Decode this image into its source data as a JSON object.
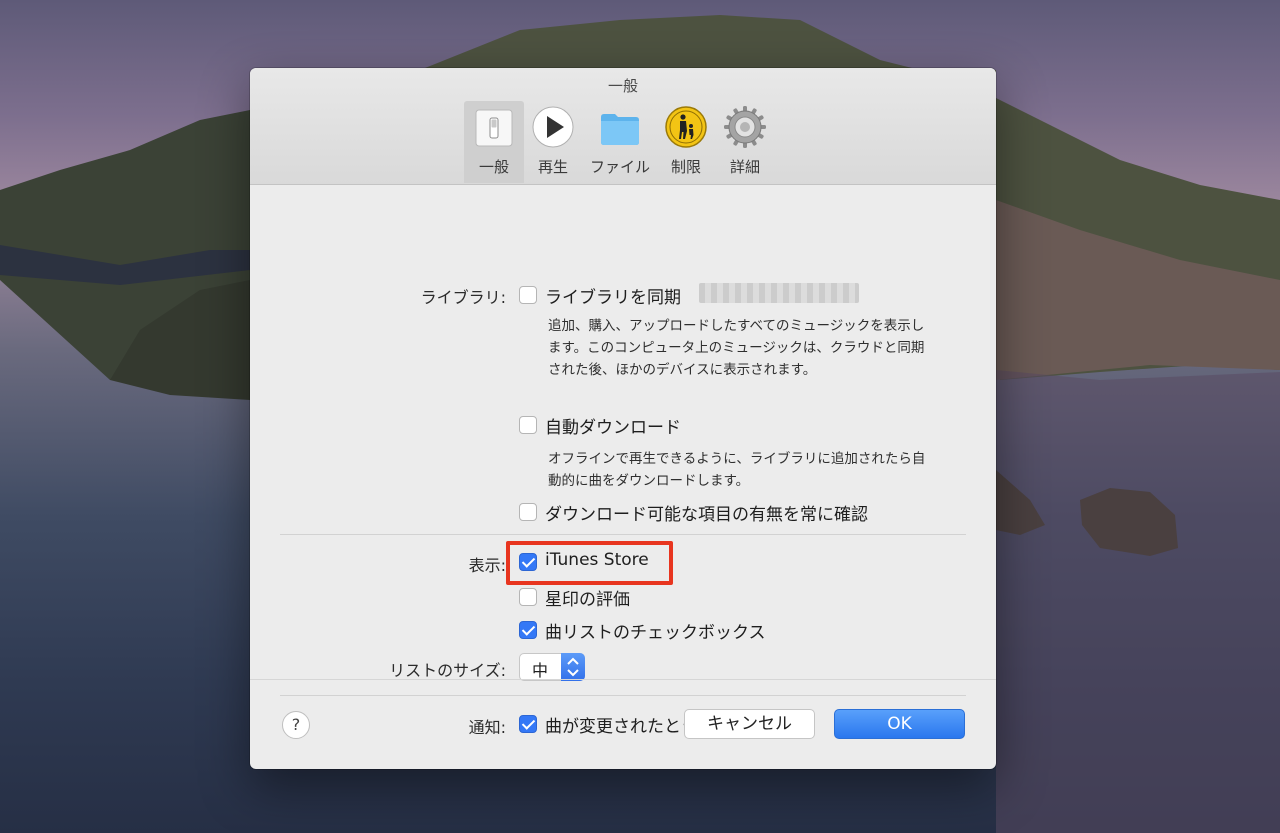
{
  "window": {
    "title": "一般"
  },
  "tabs": [
    {
      "label": "一般",
      "icon": "general-switch-icon",
      "selected": true
    },
    {
      "label": "再生",
      "icon": "play-icon",
      "selected": false
    },
    {
      "label": "ファイル",
      "icon": "folder-icon",
      "selected": false
    },
    {
      "label": "制限",
      "icon": "parental-controls-icon",
      "selected": false
    },
    {
      "label": "詳細",
      "icon": "gear-icon",
      "selected": false
    }
  ],
  "library": {
    "label": "ライブラリ:",
    "sync_label": "ライブラリを同期",
    "sync_checked": false,
    "sync_description": "追加、購入、アップロードしたすべてのミュージックを表示します。このコンピュータ上のミュージックは、クラウドと同期された後、ほかのデバイスに表示されます。",
    "auto_download_label": "自動ダウンロード",
    "auto_download_checked": false,
    "auto_download_description": "オフラインで再生できるように、ライブラリに追加されたら自動的に曲をダウンロードします。",
    "check_downloads_label": "ダウンロード可能な項目の有無を常に確認",
    "check_downloads_checked": false
  },
  "display": {
    "label": "表示:",
    "itunes_store_label": "iTunes Store",
    "itunes_store_checked": true,
    "star_ratings_label": "星印の評価",
    "star_ratings_checked": false,
    "song_checkboxes_label": "曲リストのチェックボックス",
    "song_checkboxes_checked": true
  },
  "list_size": {
    "label": "リストのサイズ:",
    "value": "中"
  },
  "notifications": {
    "label": "通知:",
    "song_changes_label": "曲が変更されたとき",
    "song_changes_checked": true
  },
  "footer": {
    "help_label": "?",
    "cancel_label": "キャンセル",
    "ok_label": "OK"
  },
  "colors": {
    "accent": "#3478f6",
    "highlight": "#e8351f"
  }
}
